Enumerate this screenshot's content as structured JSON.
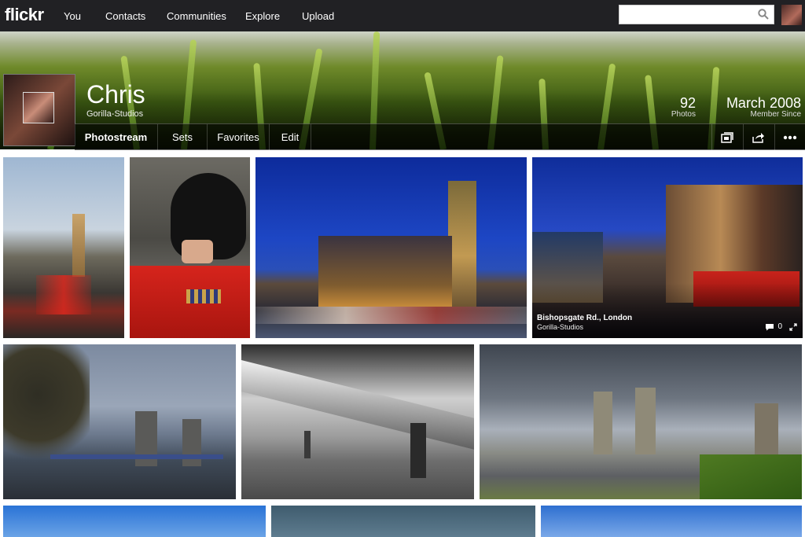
{
  "app": {
    "logo": "flickr"
  },
  "nav": {
    "items": [
      "You",
      "Contacts",
      "Communities",
      "Explore",
      "Upload"
    ]
  },
  "search": {
    "placeholder": ""
  },
  "profile": {
    "name": "Chris",
    "subtitle": "Gorilla-Studios",
    "photos_count": "92",
    "photos_label": "Photos",
    "member_since": "March 2008",
    "member_since_label": "Member Since"
  },
  "tabs": [
    "Photostream",
    "Sets",
    "Favorites",
    "Edit"
  ],
  "toolbar": {
    "icons": [
      "slideshow-icon",
      "share-icon",
      "more-icon"
    ]
  },
  "photos": [
    {
      "subject": "Big Ben with red bus"
    },
    {
      "subject": "Queen's guard"
    },
    {
      "subject": "Houses of Parliament at night"
    },
    {
      "subject": "Bishopsgate street",
      "title": "Bishopsgate Rd., London",
      "owner": "Gorilla-Studios",
      "comments": "0"
    },
    {
      "subject": "Tower Bridge at dusk"
    },
    {
      "subject": "Millennium Bridge black and white"
    },
    {
      "subject": "Tower Bridge cloudy day"
    },
    {
      "subject": "Sky row 3a"
    },
    {
      "subject": "Sky row 3b"
    },
    {
      "subject": "Sky row 3c"
    }
  ]
}
